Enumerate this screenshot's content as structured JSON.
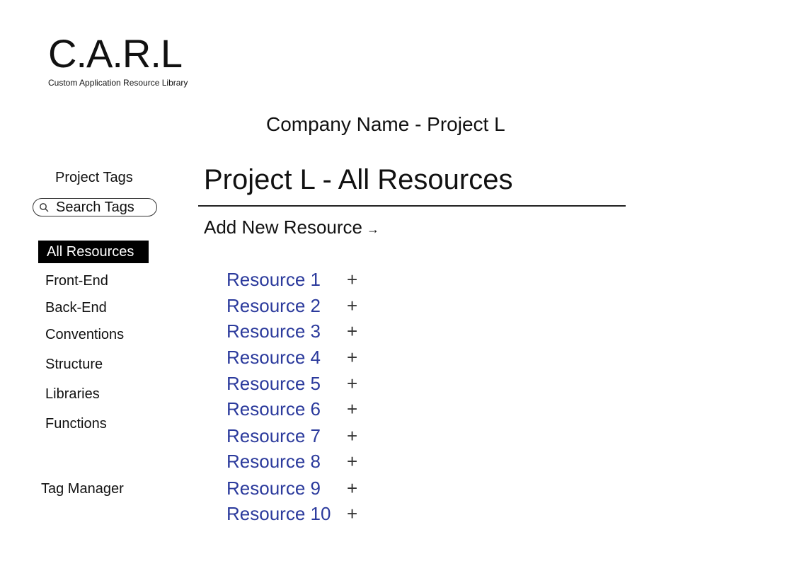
{
  "logo": {
    "title": "C.A.R.L",
    "subtitle": "Custom Application Resource Library"
  },
  "header": {
    "company_project": "Company Name - Project L"
  },
  "sidebar": {
    "heading": "Project Tags",
    "search_label": "Search Tags",
    "search_icon": "search-icon",
    "active_tag": "All Resources",
    "tags": [
      "Front-End",
      "Back-End",
      "Conventions",
      "Structure",
      "Libraries",
      "Functions"
    ],
    "tag_manager": "Tag Manager"
  },
  "main": {
    "title": "Project L - All Resources",
    "add_new": "Add New Resource",
    "add_arrow": "→",
    "plus_symbol": "+",
    "resources": [
      "Resource 1",
      "Resource 2",
      "Resource 3",
      "Resource 4",
      "Resource 5",
      "Resource 6",
      "Resource 7",
      "Resource 8",
      "Resource 9",
      "Resource 10"
    ]
  },
  "colors": {
    "link": "#2b3a9c",
    "active_tag_bg": "#000000",
    "text": "#111111"
  }
}
